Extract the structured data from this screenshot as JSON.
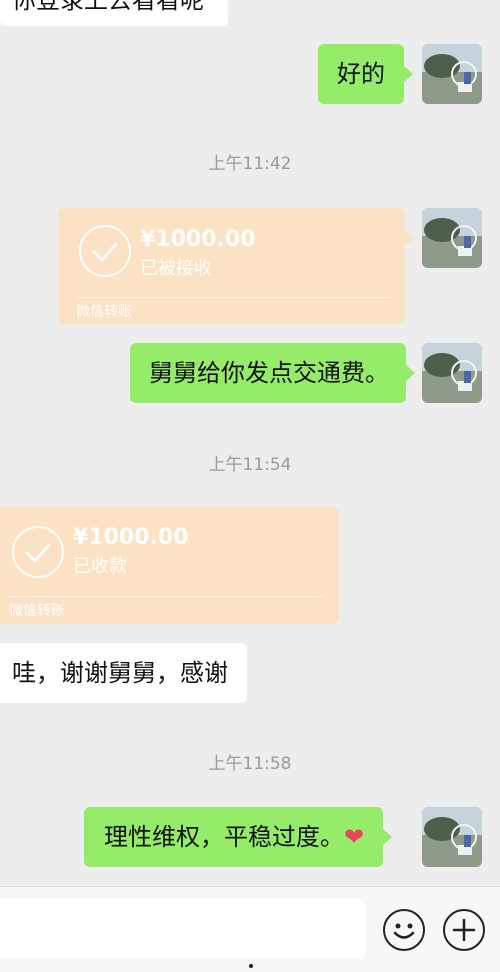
{
  "messages": {
    "partial_top": "你登录上去看看呢",
    "ok": "好的",
    "uncle_gift": "舅舅给你发点交通费。",
    "thanks": "哇，谢谢舅舅，感谢",
    "final": "理性维权，平稳过度。",
    "heart": "❤"
  },
  "timestamps": {
    "t1": "上午11:42",
    "t2": "上午11:54",
    "t3": "上午11:58"
  },
  "transfer_sent": {
    "amount": "¥1000.00",
    "status": "已被接收",
    "footer": "微信转账"
  },
  "transfer_received": {
    "amount": "¥1000.00",
    "status": "已收款",
    "footer": "微信转账"
  },
  "colors": {
    "background": "#ededed",
    "green_bubble": "#95ec69",
    "transfer_bubble": "#fce2c4"
  },
  "icons": {
    "emoji": "smiley-icon",
    "add": "plus-icon",
    "transfer": "check-circle-icon"
  }
}
